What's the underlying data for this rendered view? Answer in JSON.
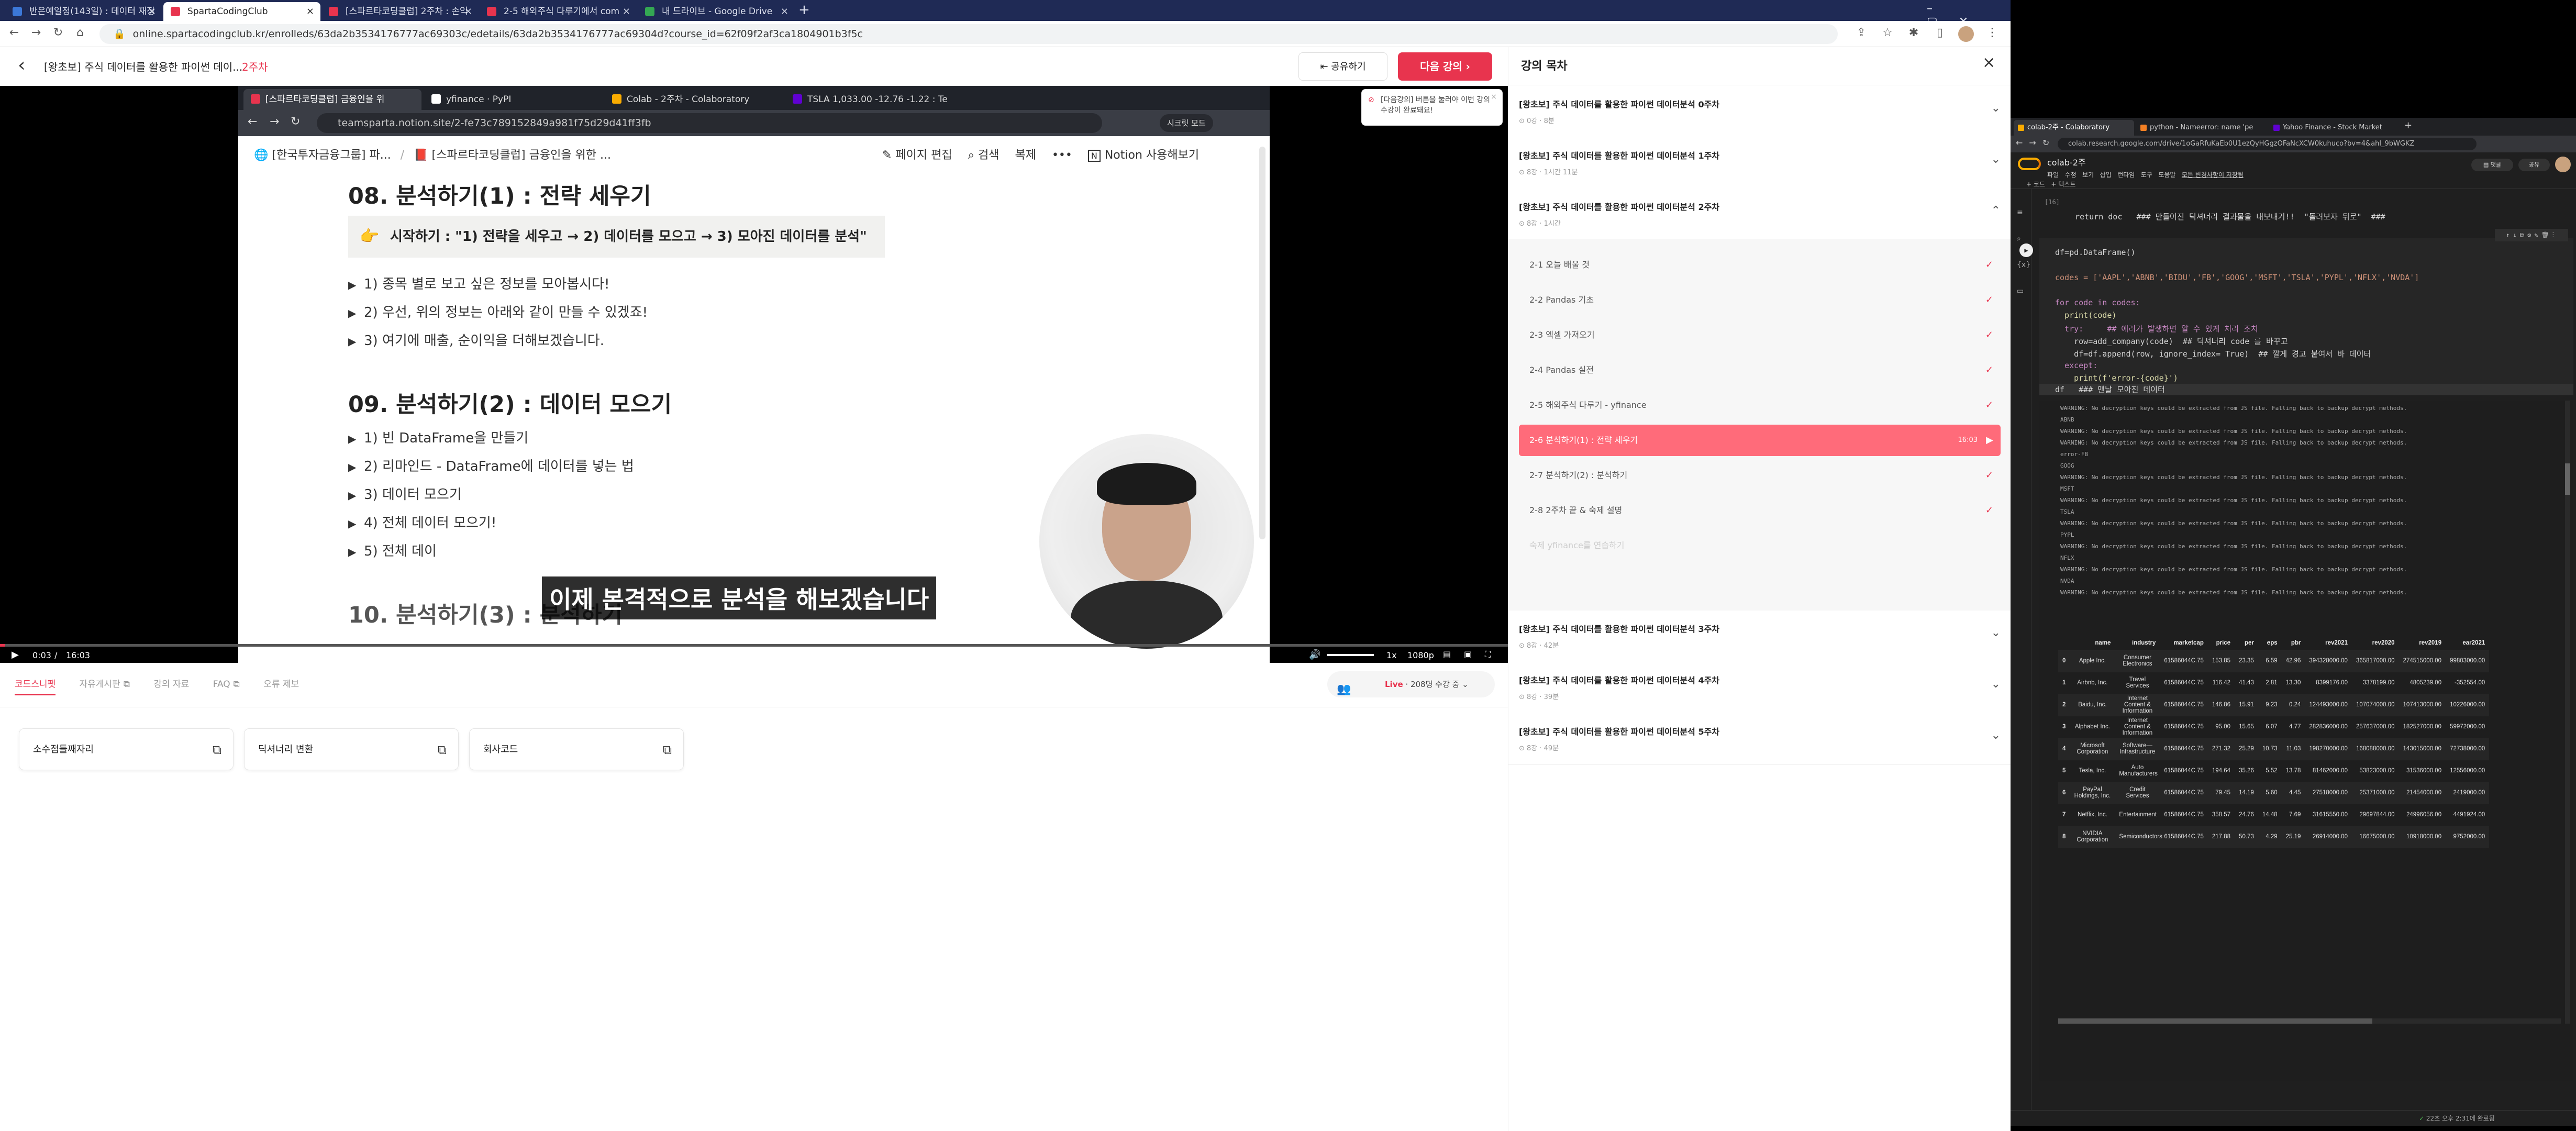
{
  "browser": {
    "tabs": [
      {
        "title": "반은예일정(143일) : 데이터 재정",
        "active": false,
        "color": "#3c78d8"
      },
      {
        "title": "SpartaCodingClub",
        "active": true,
        "color": "#e8344e"
      },
      {
        "title": "[스파르타코딩클럽] 2주차 : 손익",
        "active": false,
        "color": "#e8344e"
      },
      {
        "title": "2-5 해외주식 다루기에서 com",
        "active": false,
        "color": "#e8344e"
      },
      {
        "title": "내 드라이브 - Google Drive",
        "active": false,
        "color": "#34a853"
      }
    ],
    "url": "online.spartacodingclub.kr/enrolleds/63da2b3534176777ac69303c/edetails/63da2b3534176777ac69304d?course_id=62f09f2af3ca1804901b3f5c"
  },
  "course_header": {
    "back_icon": "‹",
    "title": "[왕초보] 주식 데이터를 활용한 파이썬 데이...",
    "week": "2주차",
    "share_label": "공유하기",
    "next_label": "다음 강의",
    "toast": "[다음강의] 버튼을 눌러야 이번 강의 수강이 완료돼요!"
  },
  "video": {
    "inner_tabs": [
      {
        "title": "[스파르타코딩클럽] 금융인을 위",
        "active": true
      },
      {
        "title": "yfinance · PyPI",
        "active": false
      },
      {
        "title": "Colab - 2주차 - Colaboratory",
        "active": false
      },
      {
        "title": "TSLA 1,033.00 -12.76 -1.22 : Te",
        "active": false
      }
    ],
    "inner_url": "teamsparta.notion.site/2-fe73c789152849a981f75d29d41ff3fb",
    "mode_label": "시크릿 모드",
    "breadcrumb1": "[한국투자금융그룹] 파...",
    "breadcrumb2": "[스파르타코딩클럽] 금융인을 위한 ...",
    "edit_label": "페이지 편집",
    "search_label": "검색",
    "copy_label": "복제",
    "try_label": "Notion 사용해보기",
    "section08_title": "08. 분석하기(1) : 전략 세우기",
    "callout_prefix": "시작하기 : \"1) ",
    "callout_b1": "전략을 세우고",
    "callout_mid1": " → 2) ",
    "callout_b2": "데이터를 모으고",
    "callout_mid2": " → 3) ",
    "callout_b3": "모아진 데이터를 분석",
    "callout_suffix": "\"",
    "section08_items": [
      "1) 종목 별로 보고 싶은 정보를 모아봅시다!",
      "2) 우선, 위의 정보는 아래와 같이 만들 수 있겠죠!",
      "3) 여기에 매출, 순이익을 더해보겠습니다."
    ],
    "section09_title": "09. 분석하기(2) : 데이터 모으기",
    "section09_items": [
      "1) 빈 DataFrame을 만들기",
      "2) 리마인드 - DataFrame에 데이터를 넣는 법",
      "3) 데이터 모으기",
      "4) 전체 데이터 모으기!",
      "5) 전체 데이"
    ],
    "section10_partial": "10. 분석하기(3) : 분석하기",
    "caption": "이제 본격적으로 분석을 해보겠습니다",
    "time_current": "0:03",
    "time_total": "16:03",
    "progress": 0.003,
    "speed": "1x",
    "quality": "1080p"
  },
  "below_video": {
    "tabs": [
      "코드스니펫",
      "자유게시판",
      "강의 자료",
      "FAQ",
      "오류 제보"
    ],
    "live_label": "Live",
    "live_count": "208명 수강 중",
    "snippets": [
      "소수점들째자리",
      "딕셔너리 변환",
      "회사코드"
    ]
  },
  "sidebar": {
    "title": "강의 목차",
    "weeks_before": [
      {
        "title": "[왕초보] 주식 데이터를 활용한 파이썬 데이터분석 0주차",
        "meta": "0강 · 8분"
      },
      {
        "title": "[왕초보] 주식 데이터를 활용한 파이썬 데이터분석 1주차",
        "meta": "8강 · 1시간 11분"
      },
      {
        "title": "[왕초보] 주식 데이터를 활용한 파이썬 데이터분석 2주차",
        "meta": "8강 · 1시간"
      }
    ],
    "lessons": [
      {
        "label": "2-1  오늘 배울 것",
        "time": "",
        "current": false
      },
      {
        "label": "2-2  Pandas 기초",
        "time": "",
        "current": false
      },
      {
        "label": "2-3  엑셀 가져오기",
        "time": "",
        "current": false
      },
      {
        "label": "2-4  Pandas 실전",
        "time": "",
        "current": false
      },
      {
        "label": "2-5  해외주식 다루기 - yfinance",
        "time": "",
        "current": false
      },
      {
        "label": "2-6  분석하기(1) : 전략 세우기",
        "time": "16:03",
        "current": true
      },
      {
        "label": "2-7  분석하기(2) : 분석하기",
        "time": "",
        "current": false
      },
      {
        "label": "2-8  2주차 끝 & 숙제 설명",
        "time": "",
        "current": false
      },
      {
        "label": "숙제  yfinance를 연습하기",
        "time": "",
        "current": false
      }
    ],
    "weeks_after": [
      {
        "title": "[왕초보] 주식 데이터를 활용한 파이썬 데이터분석 3주차",
        "meta": "8강 · 42분"
      },
      {
        "title": "[왕초보] 주식 데이터를 활용한 파이썬 데이터분석 4주차",
        "meta": "8강 · 39분"
      },
      {
        "title": "[왕초보] 주식 데이터를 활용한 파이썬 데이터분석 5주차",
        "meta": "8강 · 49분"
      }
    ]
  },
  "colab": {
    "tabs": [
      "colab-2주 - Colaboratory",
      "python - Nameerror: name 'pe",
      "Yahoo Finance - Stock Market"
    ],
    "url": "colab.research.google.com/drive/1oGaRfuKaEb0U1ezQyHGgzOFaNcXCW0kuhuco?bv=4&ahl_9bWGKZ",
    "title": "colab-2주",
    "menu": [
      "파일",
      "수정",
      "보기",
      "삽입",
      "런타임",
      "도구",
      "도움말",
      "모든 변경사항이 저장됨"
    ],
    "add_code": "+ 코드",
    "add_text": "+ 텍스트",
    "cell_prev_line": "  return doc   ### 만들어진 딕셔너리 결과물을 내보내기!!  \"돌려보자 뒤로\"  ###",
    "code_lines": [
      "df=pd.DataFrame()",
      "",
      "codes = ['AAPL','ABNB','BIDU','FB','GOOG','MSFT','TSLA','PYPL','NFLX','NVDA']",
      "",
      "for code in codes:",
      "  print(code)",
      "  try:     ## 에러가 발생하면 알 수 있게 처리 조치",
      "    row=add_company(code)  ## 딕셔너리 code 를 바꾸고",
      "    df=df.append(row, ignore_index= True)  ## 깔게 경고 붙여서 바 데이터",
      "  except:",
      "    print(f'error-{code}')",
      "df   ### 맨날 모아진 데이터"
    ],
    "warnings": [
      "WARNING: No decryption keys could be extracted from JS file. Falling back to backup decrypt methods.",
      "ABNB",
      "WARNING: No decryption keys could be extracted from JS file. Falling back to backup decrypt methods.",
      "WARNING: No decryption keys could be extracted from JS file. Falling back to backup decrypt methods.",
      "error-FB",
      "GOOG",
      "WARNING: No decryption keys could be extracted from JS file. Falling back to backup decrypt methods.",
      "MSFT",
      "WARNING: No decryption keys could be extracted from JS file. Falling back to backup decrypt methods.",
      "TSLA",
      "WARNING: No decryption keys could be extracted from JS file. Falling back to backup decrypt methods.",
      "PYPL",
      "WARNING: No decryption keys could be extracted from JS file. Falling back to backup decrypt methods.",
      "NFLX",
      "WARNING: No decryption keys could be extracted from JS file. Falling back to backup decrypt methods.",
      "NVDA",
      "WARNING: No decryption keys could be extracted from JS file. Falling back to backup decrypt methods."
    ],
    "table": {
      "columns": [
        "",
        "name",
        "industry",
        "marketcap",
        "price",
        "per",
        "eps",
        "pbr",
        "rev2021",
        "rev2020",
        "rev2019",
        "ear2021"
      ],
      "rows": [
        [
          "0",
          "Apple Inc.",
          "Consumer Electronics",
          "61586044C.75",
          "153.85",
          "23.35",
          "6.59",
          "42.96",
          "394328000.00",
          "365817000.00",
          "274515000.00",
          "99803000.00"
        ],
        [
          "1",
          "Airbnb, Inc.",
          "Travel Services",
          "61586044C.75",
          "116.42",
          "41.43",
          "2.81",
          "13.30",
          "8399176.00",
          "3378199.00",
          "4805239.00",
          "-352554.00"
        ],
        [
          "2",
          "Baidu, Inc.",
          "Internet Content & Information",
          "61586044C.75",
          "146.86",
          "15.91",
          "9.23",
          "0.24",
          "124493000.00",
          "107074000.00",
          "107413000.00",
          "10226000.00"
        ],
        [
          "3",
          "Alphabet Inc.",
          "Internet Content & Information",
          "61586044C.75",
          "95.00",
          "15.65",
          "6.07",
          "4.77",
          "282836000.00",
          "257637000.00",
          "182527000.00",
          "59972000.00"
        ],
        [
          "4",
          "Microsoft Corporation",
          "Software—Infrastructure",
          "61586044C.75",
          "271.32",
          "25.29",
          "10.73",
          "11.03",
          "198270000.00",
          "168088000.00",
          "143015000.00",
          "72738000.00"
        ],
        [
          "5",
          "Tesla, Inc.",
          "Auto Manufacturers",
          "61586044C.75",
          "194.64",
          "35.26",
          "5.52",
          "13.78",
          "81462000.00",
          "53823000.00",
          "31536000.00",
          "12556000.00"
        ],
        [
          "6",
          "PayPal Holdings, Inc.",
          "Credit Services",
          "61586044C.75",
          "79.45",
          "14.19",
          "5.60",
          "4.45",
          "27518000.00",
          "25371000.00",
          "21454000.00",
          "2419000.00"
        ],
        [
          "7",
          "Netflix, Inc.",
          "Entertainment",
          "61586044C.75",
          "358.57",
          "24.76",
          "14.48",
          "7.69",
          "31615550.00",
          "29697844.00",
          "24996056.00",
          "4491924.00"
        ],
        [
          "8",
          "NVIDIA Corporation",
          "Semiconductors",
          "61586044C.75",
          "217.88",
          "50.73",
          "4.29",
          "25.19",
          "26914000.00",
          "16675000.00",
          "10918000.00",
          "9752000.00"
        ]
      ]
    },
    "status": "22초   오후 2:31에 완료됨"
  }
}
